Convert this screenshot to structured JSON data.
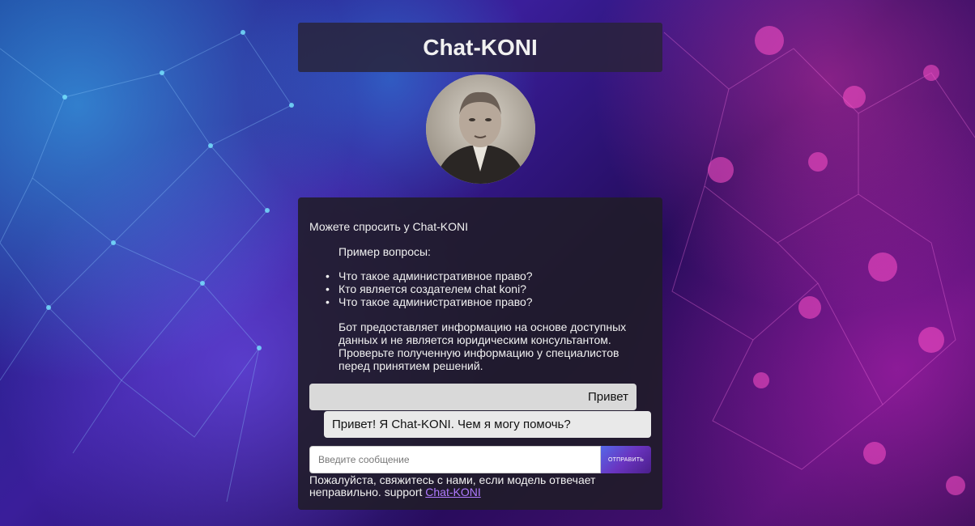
{
  "header": {
    "title": "Chat-KONI"
  },
  "avatar": {
    "icon": "portrait-avatar"
  },
  "intro": {
    "text": "Можете спросить у Chat-KONI",
    "examples_title": "Пример вопросы:",
    "examples": [
      "Что такое административное право?",
      "Кто является создателем chat koni?",
      "Что такое административное право?"
    ],
    "disclaimer": "Бот предоставляет информацию на основе доступных данных и не является юридическим консультантом. Проверьте полученную информацию у специалистов перед принятием решений."
  },
  "messages": [
    {
      "role": "user",
      "text": "Привет"
    },
    {
      "role": "bot",
      "text": "Привет! Я Chat-KONI. Чем я могу помочь?"
    }
  ],
  "composer": {
    "placeholder": "Введите сообщение",
    "value": "",
    "send_label": "ОТПРАВИТЬ"
  },
  "footer": {
    "text": "Пожалуйста, свяжитесь с нами, если модель отвечает неправильно. support ",
    "link_text": "Chat-KONI"
  },
  "colors": {
    "accent": "#6a34c0",
    "link": "#b07aff"
  }
}
